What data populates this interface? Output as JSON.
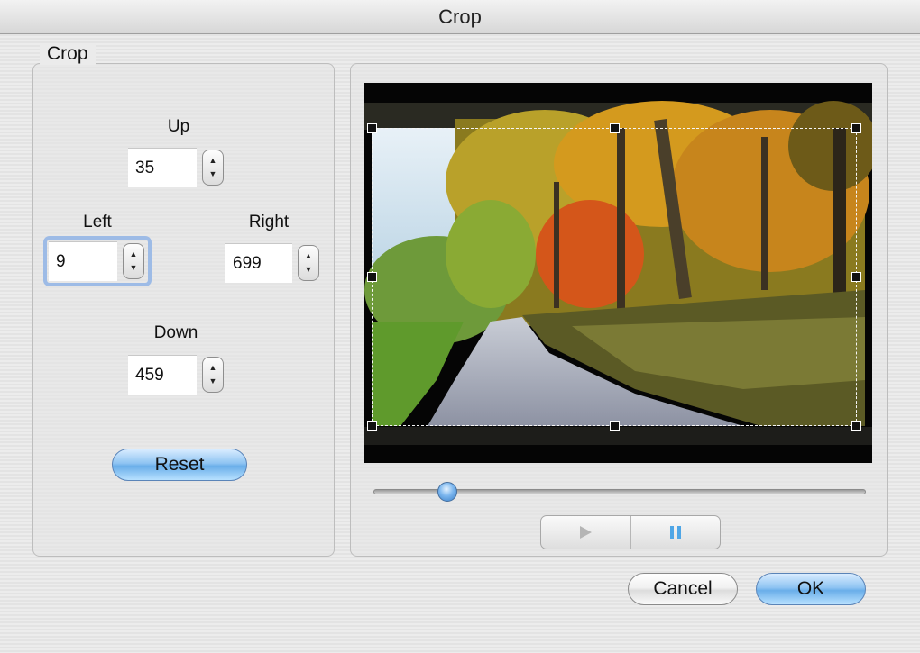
{
  "window": {
    "title": "Crop"
  },
  "crop_panel": {
    "legend": "Crop",
    "up": {
      "label": "Up",
      "value": "35"
    },
    "left": {
      "label": "Left",
      "value": "9"
    },
    "right": {
      "label": "Right",
      "value": "699"
    },
    "down": {
      "label": "Down",
      "value": "459"
    },
    "reset_label": "Reset"
  },
  "preview": {
    "playback_position": 0.15,
    "play_icon": "play-icon",
    "pause_icon": "pause-icon"
  },
  "footer": {
    "cancel_label": "Cancel",
    "ok_label": "OK"
  },
  "colors": {
    "accent": "#6aaee9",
    "pause_icon": "#4fa6e6"
  }
}
